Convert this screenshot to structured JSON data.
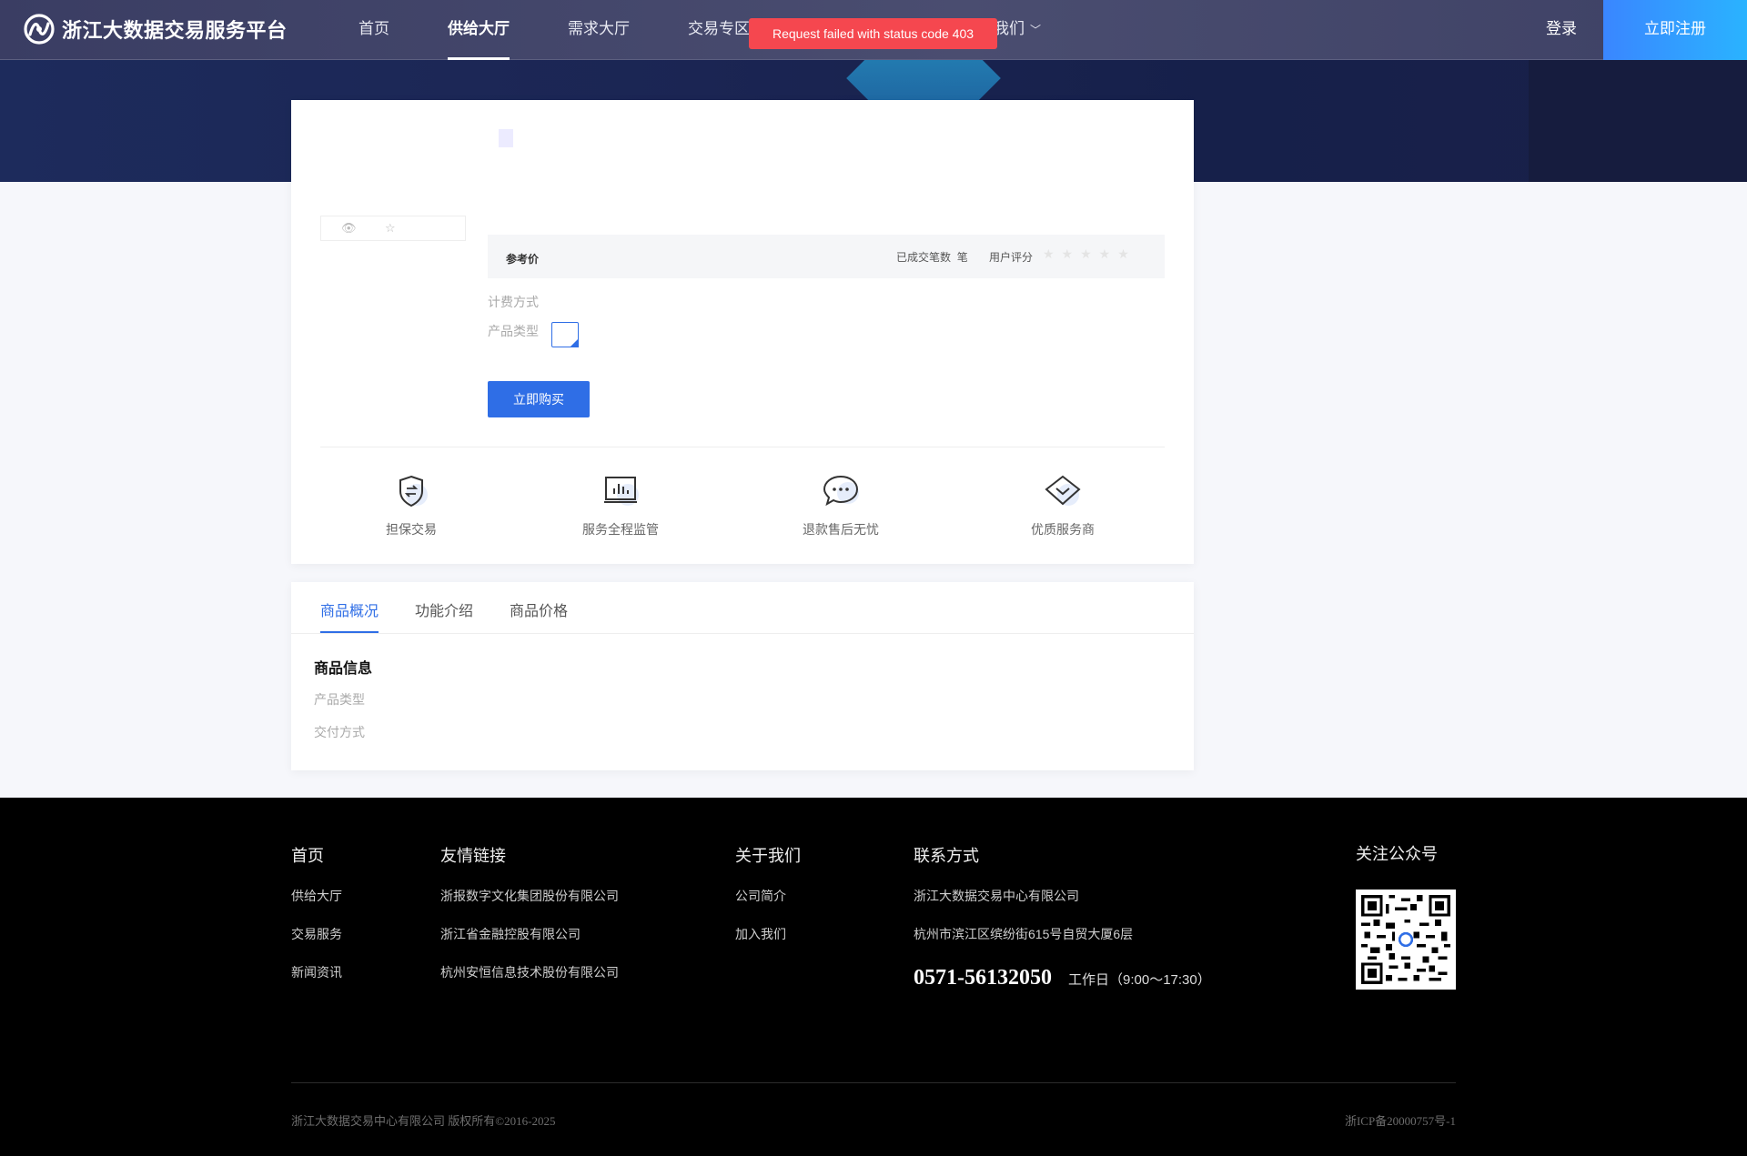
{
  "header": {
    "logo_text": "浙江大数据交易服务平台",
    "nav": [
      {
        "label": "首页"
      },
      {
        "label": "供给大厅",
        "active": true
      },
      {
        "label": "需求大厅"
      },
      {
        "label": "交易专区"
      }
    ],
    "nav_more_label": "我们",
    "login_label": "登录",
    "register_label": "立即注册"
  },
  "toast": {
    "message": "Request failed with status code 403",
    "color": "#f5474f"
  },
  "product": {
    "price_label": "参考价",
    "deals_label": "已成交笔数",
    "deals_unit": "笔",
    "rating_label": "用户评分",
    "rating_stars": "★★★★★",
    "billing_label": "计费方式",
    "type_label": "产品类型",
    "buy_label": "立即购买",
    "features": [
      {
        "label": "担保交易",
        "icon": "shield-exchange-icon"
      },
      {
        "label": "服务全程监管",
        "icon": "monitor-chart-icon"
      },
      {
        "label": "退款售后无忧",
        "icon": "chat-bubble-icon"
      },
      {
        "label": "优质服务商",
        "icon": "diamond-icon"
      }
    ]
  },
  "tabs": [
    {
      "label": "商品概况",
      "active": true
    },
    {
      "label": "功能介绍"
    },
    {
      "label": "商品价格"
    }
  ],
  "info": {
    "title": "商品信息",
    "rows": [
      "产品类型",
      "交付方式"
    ]
  },
  "footer": {
    "col_home": {
      "head": "首页",
      "links": [
        "供给大厅",
        "交易服务",
        "新闻资讯"
      ]
    },
    "col_friends": {
      "head": "友情链接",
      "links": [
        "浙报数字文化集团股份有限公司",
        "浙江省金融控股有限公司",
        "杭州安恒信息技术股份有限公司"
      ]
    },
    "col_about": {
      "head": "关于我们",
      "links": [
        "公司简介",
        "加入我们"
      ]
    },
    "col_contact": {
      "head": "联系方式",
      "company": "浙江大数据交易中心有限公司",
      "address": "杭州市滨江区缤纷街615号自贸大厦6层",
      "phone": "0571-56132050",
      "hours": "工作日（9:00～17:30）"
    },
    "qr_head": "关注公众号",
    "copyright": "浙江大数据交易中心有限公司 版权所有©2016-2025",
    "icp": "浙ICP备20000757号-1"
  },
  "colors": {
    "accent": "#2f6ee6",
    "header_bg": "#4a4d70",
    "footer_bg": "#000000"
  }
}
